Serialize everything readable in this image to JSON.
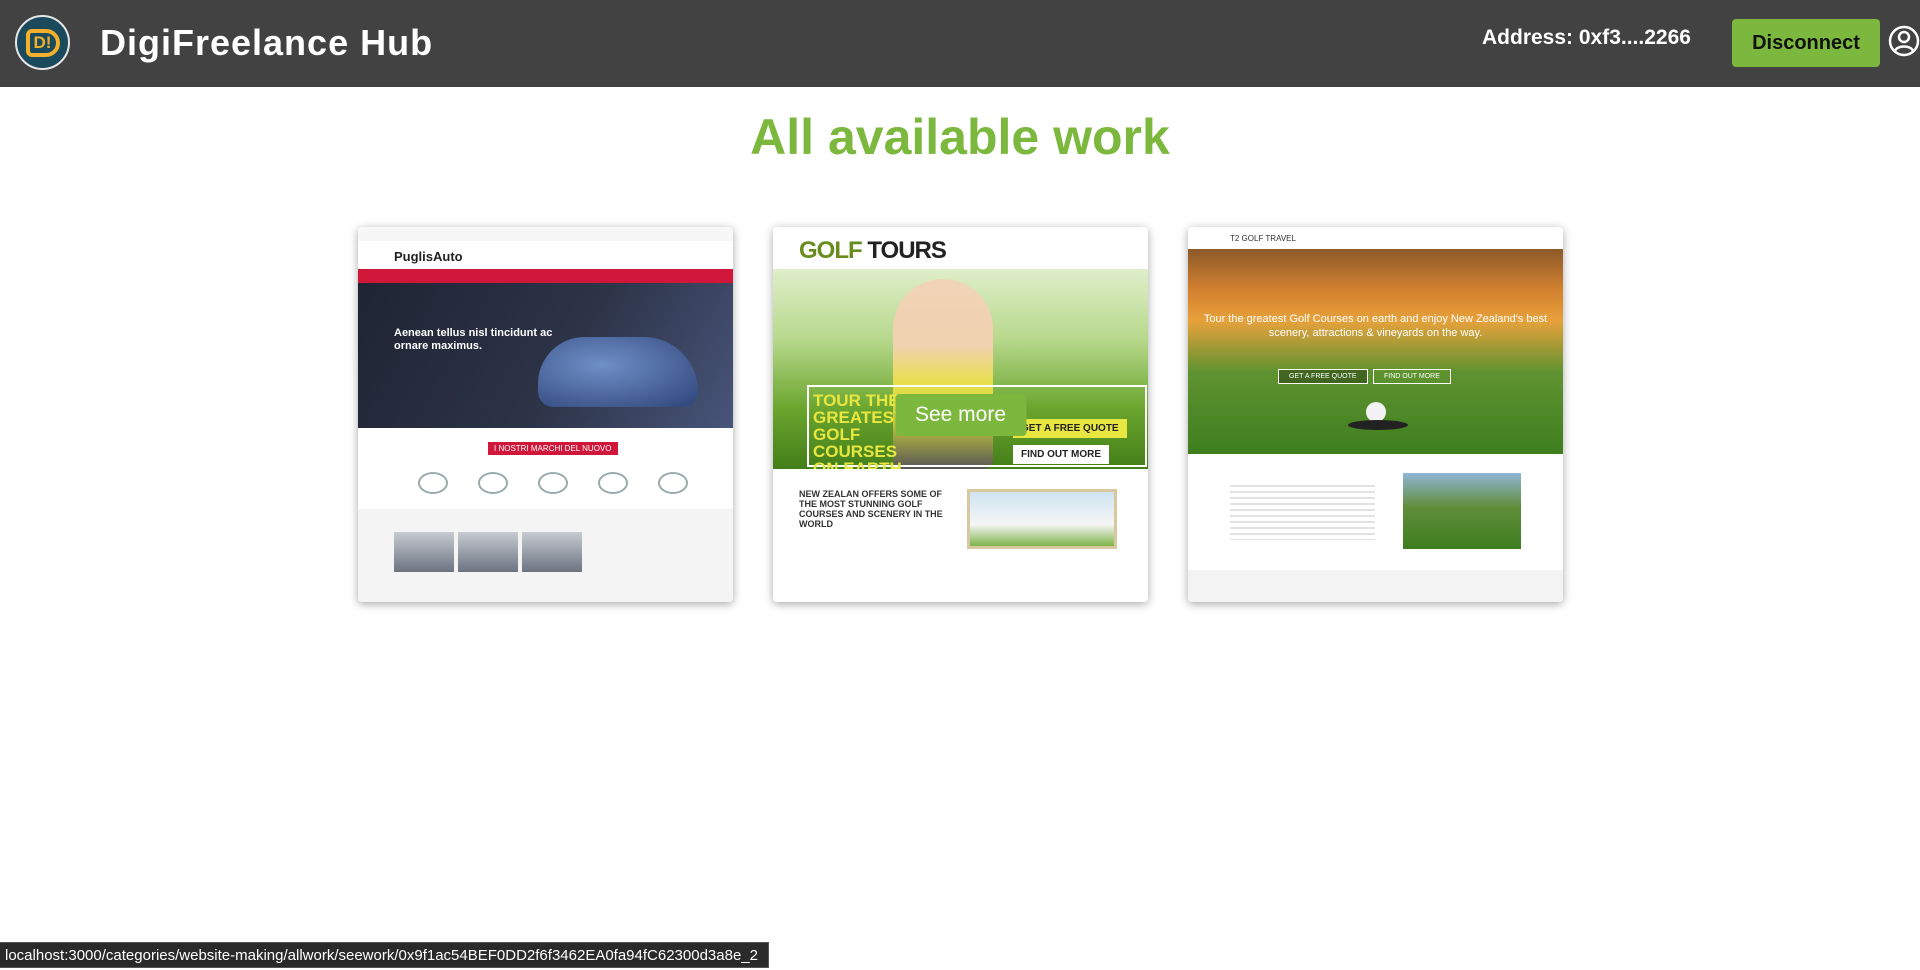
{
  "header": {
    "logo_text": "D!",
    "app_title": "DigiFreelance Hub",
    "address": "Address: 0xf3....2266",
    "disconnect_label": "Disconnect",
    "icons": {
      "user": "user-circle-icon"
    }
  },
  "main": {
    "title": "All available work",
    "cards": [
      {
        "preview": {
          "logo": "PuglisAuto",
          "hero_text": "Aenean tellus nisl tincidunt ac ornare maximus.",
          "band": "I NOSTRI MARCHI DEL NUOVO"
        }
      },
      {
        "preview": {
          "logo_a": "GOLF",
          "logo_b": "TOURS",
          "hero_text": "TOUR THE GREATEST GOLF COURSES ON EARTH",
          "quote": "GET A FREE QUOTE",
          "more": "FIND OUT MORE",
          "bottom_text": "NEW ZEALAN OFFERS SOME OF THE MOST STUNNING GOLF COURSES AND SCENERY IN THE WORLD"
        },
        "hover_label": "See more"
      },
      {
        "preview": {
          "logo": "T2 GOLF TRAVEL",
          "hero_text": "Tour the greatest Golf Courses on earth and enjoy New Zealand's best scenery, attractions & vineyards on the way.",
          "quote": "GET A FREE QUOTE",
          "more": "FIND OUT MORE"
        }
      }
    ]
  },
  "status_bar": {
    "url": "localhost:3000/categories/website-making/allwork/seework/0x9f1ac54BEF0DD2f6f3462EA0fa94fC62300d3a8e_2"
  },
  "colors": {
    "header_bg": "#424242",
    "accent": "#7cb83e"
  }
}
